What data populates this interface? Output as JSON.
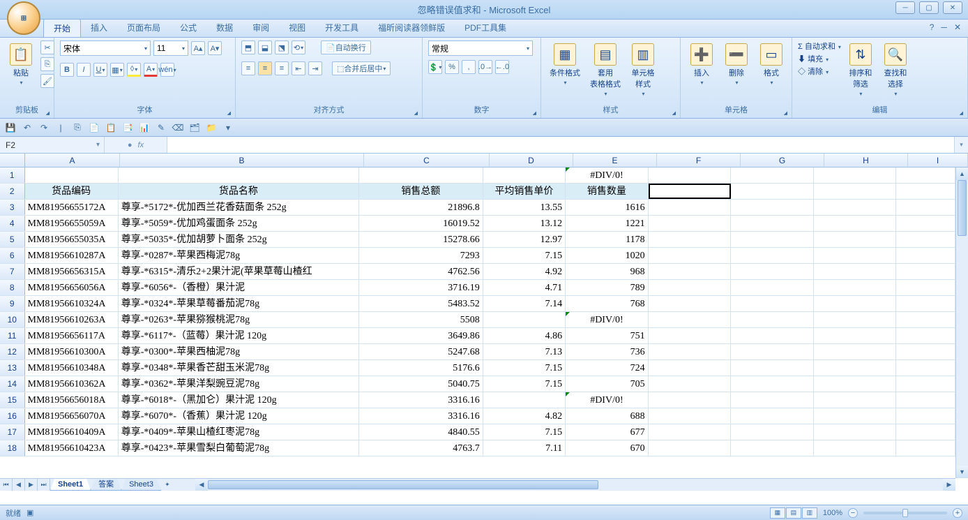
{
  "app": {
    "title": "忽略错误值求和 - Microsoft Excel",
    "office_label": "Office"
  },
  "win": {
    "min": "─",
    "max": "▢",
    "close": "✕"
  },
  "tabs": {
    "items": [
      "开始",
      "插入",
      "页面布局",
      "公式",
      "数据",
      "审阅",
      "视图",
      "开发工具",
      "福昕阅读器领鲜版",
      "PDF工具集"
    ],
    "active_index": 0
  },
  "help": {
    "q": "?",
    "min": "─",
    "close": "✕"
  },
  "ribbon": {
    "clipboard": {
      "paste": "粘贴",
      "group": "剪贴板"
    },
    "font": {
      "name": "宋体",
      "size": "11",
      "group": "字体",
      "bold": "B",
      "italic": "I",
      "underline": "U"
    },
    "align": {
      "wrap": "自动换行",
      "merge": "合并后居中",
      "group": "对齐方式"
    },
    "number": {
      "format": "常规",
      "group": "数字"
    },
    "styles": {
      "cond": "条件格式",
      "table": "套用\n表格格式",
      "cell": "单元格\n样式",
      "group": "样式"
    },
    "cells": {
      "insert": "插入",
      "delete": "删除",
      "format": "格式",
      "group": "单元格"
    },
    "editing": {
      "autosum": "自动求和",
      "fill": "填充",
      "clear": "清除",
      "sort": "排序和\n筛选",
      "find": "查找和\n选择",
      "group": "编辑"
    }
  },
  "namebox": {
    "value": "F2"
  },
  "formula": {
    "fx": "fx",
    "value": ""
  },
  "columns": [
    "A",
    "B",
    "C",
    "D",
    "E",
    "F",
    "G",
    "H",
    "I"
  ],
  "headers": {
    "code": "货品编码",
    "name": "货品名称",
    "total": "销售总额",
    "avg": "平均销售单价",
    "qty": "销售数量"
  },
  "e1": "#DIV/0!",
  "rows": [
    {
      "n": 3,
      "code": "MM81956655172A",
      "name": "尊享-*5172*-优加西兰花香菇面条 252g",
      "total": "21896.8",
      "avg": "13.55",
      "qty": "1616"
    },
    {
      "n": 4,
      "code": "MM81956655059A",
      "name": "尊享-*5059*-优加鸡蛋面条 252g",
      "total": "16019.52",
      "avg": "13.12",
      "qty": "1221"
    },
    {
      "n": 5,
      "code": "MM81956655035A",
      "name": "尊享-*5035*-优加胡萝卜面条 252g",
      "total": "15278.66",
      "avg": "12.97",
      "qty": "1178"
    },
    {
      "n": 6,
      "code": "MM81956610287A",
      "name": "尊享-*0287*-苹果西梅泥78g",
      "total": "7293",
      "avg": "7.15",
      "qty": "1020"
    },
    {
      "n": 7,
      "code": "MM81956656315A",
      "name": "尊享-*6315*-清乐2+2果汁泥(苹果草莓山楂红",
      "total": "4762.56",
      "avg": "4.92",
      "qty": "968"
    },
    {
      "n": 8,
      "code": "MM81956656056A",
      "name": "尊享-*6056*-（香橙）果汁泥",
      "total": "3716.19",
      "avg": "4.71",
      "qty": "789"
    },
    {
      "n": 9,
      "code": "MM81956610324A",
      "name": "尊享-*0324*-苹果草莓番茄泥78g",
      "total": "5483.52",
      "avg": "7.14",
      "qty": "768"
    },
    {
      "n": 10,
      "code": "MM81956610263A",
      "name": "尊享-*0263*-苹果猕猴桃泥78g",
      "total": "5508",
      "avg": "",
      "qty": "#DIV/0!",
      "err": true
    },
    {
      "n": 11,
      "code": "MM81956656117A",
      "name": "尊享-*6117*-（蓝莓）果汁泥 120g",
      "total": "3649.86",
      "avg": "4.86",
      "qty": "751"
    },
    {
      "n": 12,
      "code": "MM81956610300A",
      "name": "尊享-*0300*-苹果西柚泥78g",
      "total": "5247.68",
      "avg": "7.13",
      "qty": "736"
    },
    {
      "n": 13,
      "code": "MM81956610348A",
      "name": "尊享-*0348*-苹果香芒甜玉米泥78g",
      "total": "5176.6",
      "avg": "7.15",
      "qty": "724"
    },
    {
      "n": 14,
      "code": "MM81956610362A",
      "name": "尊享-*0362*-苹果洋梨豌豆泥78g",
      "total": "5040.75",
      "avg": "7.15",
      "qty": "705"
    },
    {
      "n": 15,
      "code": "MM81956656018A",
      "name": "尊享-*6018*-（黑加仑）果汁泥 120g",
      "total": "3316.16",
      "avg": "",
      "qty": "#DIV/0!",
      "err": true
    },
    {
      "n": 16,
      "code": "MM81956656070A",
      "name": "尊享-*6070*-（香蕉）果汁泥 120g",
      "total": "3316.16",
      "avg": "4.82",
      "qty": "688"
    },
    {
      "n": 17,
      "code": "MM81956610409A",
      "name": "尊享-*0409*-苹果山楂红枣泥78g",
      "total": "4840.55",
      "avg": "7.15",
      "qty": "677"
    },
    {
      "n": 18,
      "code": "MM81956610423A",
      "name": "尊享-*0423*-苹果雪梨白葡萄泥78g",
      "total": "4763.7",
      "avg": "7.11",
      "qty": "670"
    }
  ],
  "sheets": {
    "items": [
      "Sheet1",
      "答案",
      "Sheet3"
    ],
    "active_index": 0
  },
  "status": {
    "ready": "就绪",
    "zoom": "100%"
  }
}
